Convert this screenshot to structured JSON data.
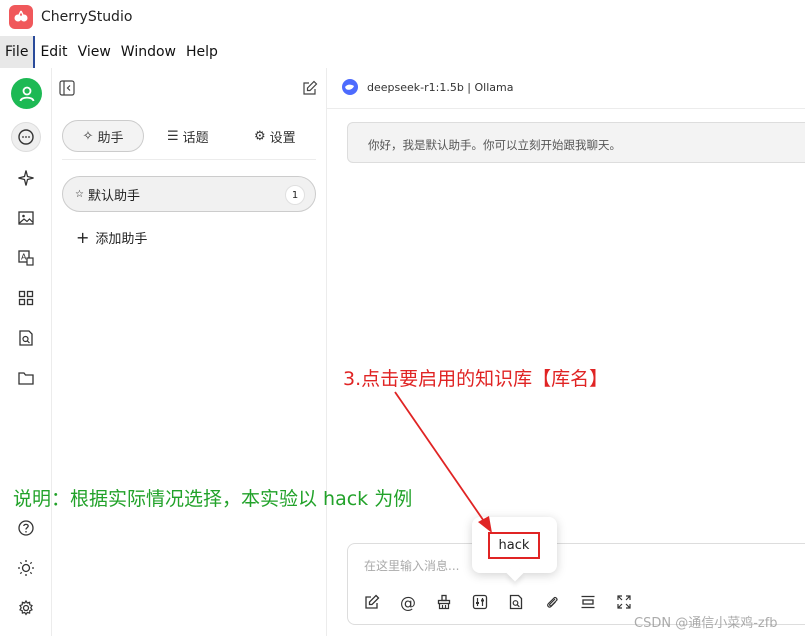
{
  "app": {
    "title": "CherryStudio"
  },
  "menu": [
    "File",
    "Edit",
    "View",
    "Window",
    "Help"
  ],
  "sidebar_tabs": [
    {
      "label": "助手",
      "icon": "sparkle-icon"
    },
    {
      "label": "话题",
      "icon": "list-icon"
    },
    {
      "label": "设置",
      "icon": "gear-icon"
    }
  ],
  "assistant": {
    "name": "默认助手",
    "count": "1"
  },
  "add_assistant": "添加助手",
  "model": {
    "label": "deepseek-r1:1.5b | Ollama"
  },
  "greeting": "你好，我是默认助手。你可以立刻开始跟我聊天。",
  "input": {
    "placeholder": "在这里输入消息..."
  },
  "knowledge_popup": {
    "item": "hack"
  },
  "annotations": {
    "red": "3.点击要启用的知识库【库名】",
    "green": "说明：根据实际情况选择，本实验以 hack 为例"
  },
  "watermark": "CSDN @通信小菜鸡-zfb",
  "colors": {
    "annotation_red": "#e02424",
    "annotation_green": "#22a22a",
    "avatar_green": "#1db954",
    "logo_red": "#f0585b"
  }
}
